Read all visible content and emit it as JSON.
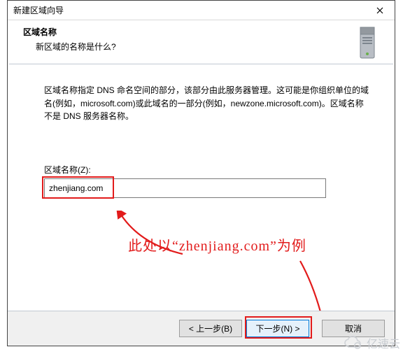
{
  "window": {
    "title": "新建区域向导"
  },
  "header": {
    "heading": "区域名称",
    "subtitle": "新区域的名称是什么?"
  },
  "body": {
    "description": "区域名称指定 DNS 命名空间的部分，该部分由此服务器管理。这可能是你组织单位的域名(例如，microsoft.com)或此域名的一部分(例如，newzone.microsoft.com)。区域名称不是 DNS 服务器名称。",
    "field_label": "区域名称(Z):",
    "zone_value": "zhenjiang.com"
  },
  "annotation": {
    "text": "此处以“zhenjiang.com”为例"
  },
  "buttons": {
    "back": "< 上一步(B)",
    "next": "下一步(N) >",
    "cancel": "取消"
  },
  "watermark": {
    "text": "亿速云"
  },
  "colors": {
    "highlight": "#e21b1b",
    "focus_border": "#0078d7"
  }
}
